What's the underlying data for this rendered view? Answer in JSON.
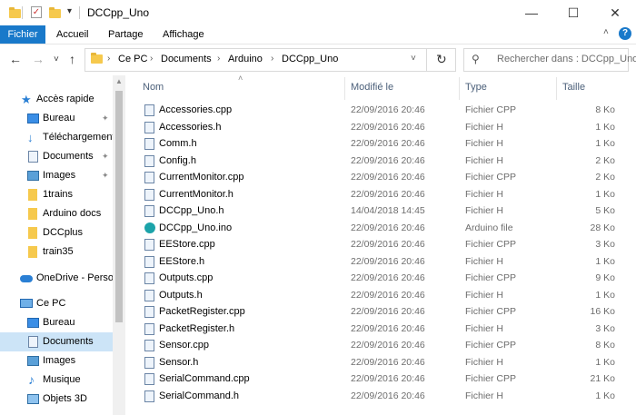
{
  "window": {
    "title": "DCCpp_Uno",
    "minimize": "—",
    "maximize": "☐",
    "close": "✕",
    "qa_dropdown": "▾"
  },
  "ribbon": {
    "tabs": [
      "Fichier",
      "Accueil",
      "Partage",
      "Affichage"
    ],
    "help": "?",
    "collapse": "˄"
  },
  "nav": {
    "back": "←",
    "forward": "→",
    "recent": "˅",
    "up": "↑",
    "breadcrumb": [
      "Ce PC",
      "Documents",
      "Arduino",
      "DCCpp_Uno"
    ],
    "refresh": "↻",
    "search_placeholder": "Rechercher dans : DCCpp_Uno"
  },
  "sidebar": {
    "items": [
      {
        "label": "Accès rapide",
        "icon": "star-icon",
        "pinned": false
      },
      {
        "label": "Bureau",
        "icon": "desktop-icon",
        "pinned": true
      },
      {
        "label": "Téléchargements",
        "icon": "download-icon",
        "pinned": true
      },
      {
        "label": "Documents",
        "icon": "documents-icon",
        "pinned": true
      },
      {
        "label": "Images",
        "icon": "images-icon",
        "pinned": true
      },
      {
        "label": "1trains",
        "icon": "folder-icon",
        "pinned": false
      },
      {
        "label": "Arduino docs",
        "icon": "folder-icon",
        "pinned": false
      },
      {
        "label": "DCCplus",
        "icon": "folder-icon",
        "pinned": false
      },
      {
        "label": "train35",
        "icon": "folder-icon",
        "pinned": false
      },
      {
        "label": "OneDrive - Personal",
        "icon": "onedrive-icon",
        "pinned": false
      },
      {
        "label": "Ce PC",
        "icon": "pc-icon",
        "pinned": false
      },
      {
        "label": "Bureau",
        "icon": "desktop-icon",
        "pinned": false
      },
      {
        "label": "Documents",
        "icon": "documents-icon",
        "pinned": false
      },
      {
        "label": "Images",
        "icon": "images-icon",
        "pinned": false
      },
      {
        "label": "Musique",
        "icon": "music-icon",
        "pinned": false
      },
      {
        "label": "Objets 3D",
        "icon": "objects3d-icon",
        "pinned": false
      }
    ],
    "pin_glyph": "📌"
  },
  "columns": {
    "name": "Nom",
    "modified": "Modifié le",
    "type": "Type",
    "size": "Taille",
    "sort_indicator": "˄"
  },
  "files": [
    {
      "name": "Accessories.cpp",
      "modified": "22/09/2016 20:46",
      "type": "Fichier CPP",
      "size": "8 Ko"
    },
    {
      "name": "Accessories.h",
      "modified": "22/09/2016 20:46",
      "type": "Fichier H",
      "size": "1 Ko"
    },
    {
      "name": "Comm.h",
      "modified": "22/09/2016 20:46",
      "type": "Fichier H",
      "size": "1 Ko"
    },
    {
      "name": "Config.h",
      "modified": "22/09/2016 20:46",
      "type": "Fichier H",
      "size": "2 Ko"
    },
    {
      "name": "CurrentMonitor.cpp",
      "modified": "22/09/2016 20:46",
      "type": "Fichier CPP",
      "size": "2 Ko"
    },
    {
      "name": "CurrentMonitor.h",
      "modified": "22/09/2016 20:46",
      "type": "Fichier H",
      "size": "1 Ko"
    },
    {
      "name": "DCCpp_Uno.h",
      "modified": "14/04/2018 14:45",
      "type": "Fichier H",
      "size": "5 Ko"
    },
    {
      "name": "DCCpp_Uno.ino",
      "modified": "22/09/2016 20:46",
      "type": "Arduino file",
      "size": "28 Ko"
    },
    {
      "name": "EEStore.cpp",
      "modified": "22/09/2016 20:46",
      "type": "Fichier CPP",
      "size": "3 Ko"
    },
    {
      "name": "EEStore.h",
      "modified": "22/09/2016 20:46",
      "type": "Fichier H",
      "size": "1 Ko"
    },
    {
      "name": "Outputs.cpp",
      "modified": "22/09/2016 20:46",
      "type": "Fichier CPP",
      "size": "9 Ko"
    },
    {
      "name": "Outputs.h",
      "modified": "22/09/2016 20:46",
      "type": "Fichier H",
      "size": "1 Ko"
    },
    {
      "name": "PacketRegister.cpp",
      "modified": "22/09/2016 20:46",
      "type": "Fichier CPP",
      "size": "16 Ko"
    },
    {
      "name": "PacketRegister.h",
      "modified": "22/09/2016 20:46",
      "type": "Fichier H",
      "size": "3 Ko"
    },
    {
      "name": "Sensor.cpp",
      "modified": "22/09/2016 20:46",
      "type": "Fichier CPP",
      "size": "8 Ko"
    },
    {
      "name": "Sensor.h",
      "modified": "22/09/2016 20:46",
      "type": "Fichier H",
      "size": "1 Ko"
    },
    {
      "name": "SerialCommand.cpp",
      "modified": "22/09/2016 20:46",
      "type": "Fichier CPP",
      "size": "21 Ko"
    },
    {
      "name": "SerialCommand.h",
      "modified": "22/09/2016 20:46",
      "type": "Fichier H",
      "size": "1 Ko"
    }
  ],
  "colors": {
    "accent": "#1979ca",
    "selection": "#cce4f7",
    "folder": "#f6c94d",
    "arduino": "#1ba3a9"
  }
}
